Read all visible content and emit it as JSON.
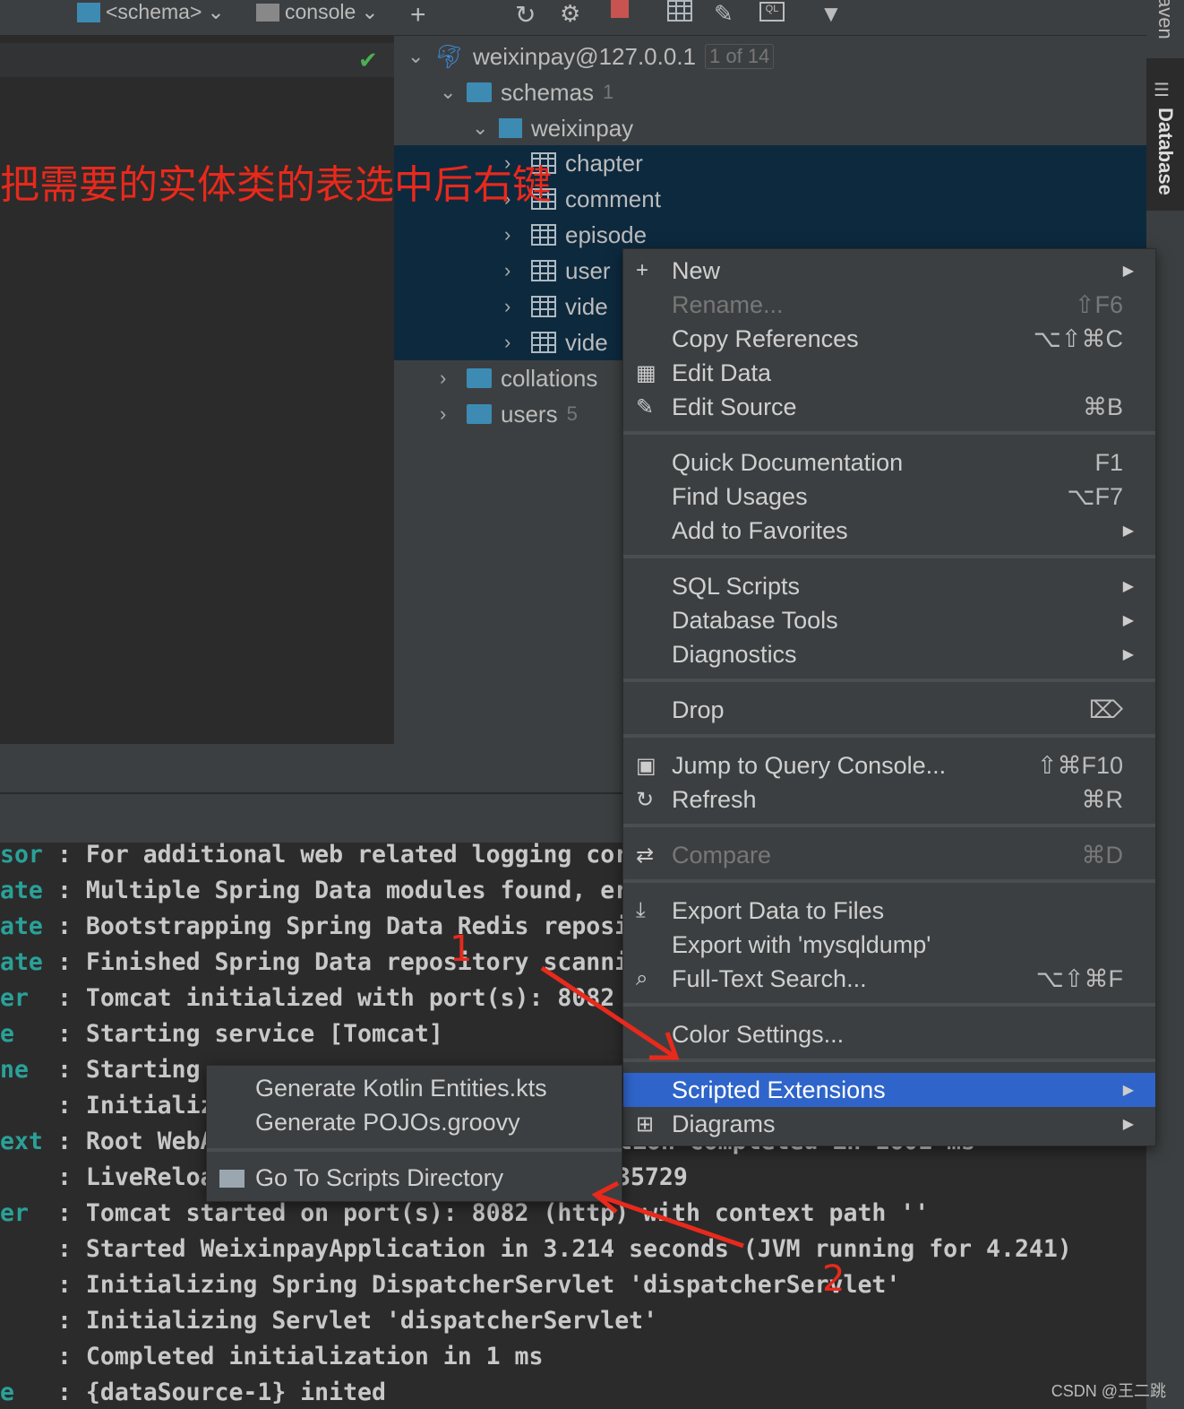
{
  "toolbar": {
    "schema": "<schema>",
    "console": "console"
  },
  "tree": {
    "connection": "weixinpay@127.0.0.1",
    "connection_badge": "1 of 14",
    "schemas": "schemas",
    "schemas_count": "1",
    "schema": "weixinpay",
    "tables": [
      "chapter",
      "comment",
      "episode",
      "user",
      "vide",
      "vide"
    ],
    "collations": "collations",
    "users": "users",
    "users_count": "5"
  },
  "right_strip": {
    "maven": "aven",
    "database": "Database"
  },
  "annotation": {
    "text": "把需要的实体类的表选中后右键",
    "marker1": "1",
    "marker2": "2"
  },
  "context_menu": {
    "items": [
      {
        "label": "New",
        "icon": "plus-icon",
        "arrow": true
      },
      {
        "label": "Rename...",
        "shortcut": "⇧F6",
        "disabled": true
      },
      {
        "label": "Copy References",
        "shortcut": "⌥⇧⌘C"
      },
      {
        "label": "Edit Data",
        "icon": "table-icon"
      },
      {
        "label": "Edit Source",
        "icon": "pencil-icon",
        "shortcut": "⌘B"
      },
      {
        "label": "Quick Documentation",
        "shortcut": "F1"
      },
      {
        "label": "Find Usages",
        "shortcut": "⌥F7"
      },
      {
        "label": "Add to Favorites",
        "arrow": true
      },
      {
        "label": "SQL Scripts",
        "arrow": true
      },
      {
        "label": "Database Tools",
        "arrow": true
      },
      {
        "label": "Diagnostics",
        "arrow": true
      },
      {
        "label": "Drop",
        "shortcut": "⌦"
      },
      {
        "label": "Jump to Query Console...",
        "icon": "ql-icon",
        "shortcut": "⇧⌘F10"
      },
      {
        "label": "Refresh",
        "icon": "refresh-icon",
        "shortcut": "⌘R"
      },
      {
        "label": "Compare",
        "icon": "compare-icon",
        "shortcut": "⌘D",
        "disabled": true
      },
      {
        "label": "Export Data to Files",
        "icon": "download-icon"
      },
      {
        "label": "Export with 'mysqldump'"
      },
      {
        "label": "Full-Text Search...",
        "icon": "search-icon",
        "shortcut": "⌥⇧⌘F"
      },
      {
        "label": "Color Settings..."
      },
      {
        "label": "Scripted Extensions",
        "arrow": true,
        "highlighted": true
      },
      {
        "label": "Diagrams",
        "icon": "diagram-icon",
        "arrow": true
      }
    ]
  },
  "submenu": {
    "items": [
      "Generate Kotlin Entities.kts",
      "Generate POJOs.groovy",
      "Go To Scripts Directory"
    ]
  },
  "console": {
    "lines": [
      {
        "p": "sor",
        "t": ": For additional web related logging cor"
      },
      {
        "p": "ate",
        "t": ": Multiple Spring Data modules found, er"
      },
      {
        "p": "ate",
        "t": ": Bootstrapping Spring Data Redis reposi"
      },
      {
        "p": "ate",
        "t": ": Finished Spring Data repository scanni"
      },
      {
        "p": "er",
        "t": ": Tomcat initialized with port(s): 8082"
      },
      {
        "p": "e",
        "t": ": Starting service [Tomcat]"
      },
      {
        "p": "ne",
        "t": ": Starting"
      },
      {
        "p": "",
        "t": ": Initializ"
      },
      {
        "p": "ext",
        "t": ": Root WebA"
      },
      {
        "p": "",
        "t": ": LiveReloa"
      },
      {
        "p": "er",
        "t": ": Tomcat started on port(s): 8082 (http) with context path ''"
      },
      {
        "p": "",
        "t": ": Started WeixinpayApplication in 3.214 seconds (JVM running for 4.241)"
      },
      {
        "p": "",
        "t": ": Initializing Spring DispatcherServlet 'dispatcherServlet'"
      },
      {
        "p": "",
        "t": ": Initializing Servlet 'dispatcherServlet'"
      },
      {
        "p": "",
        "t": ": Completed initialization in 1 ms"
      },
      {
        "p": "e",
        "t": ": {dataSource-1} inited"
      }
    ],
    "fragments": [
      "tion completed in 1601 ms",
      "35729"
    ]
  },
  "watermark": "CSDN @王二跳"
}
